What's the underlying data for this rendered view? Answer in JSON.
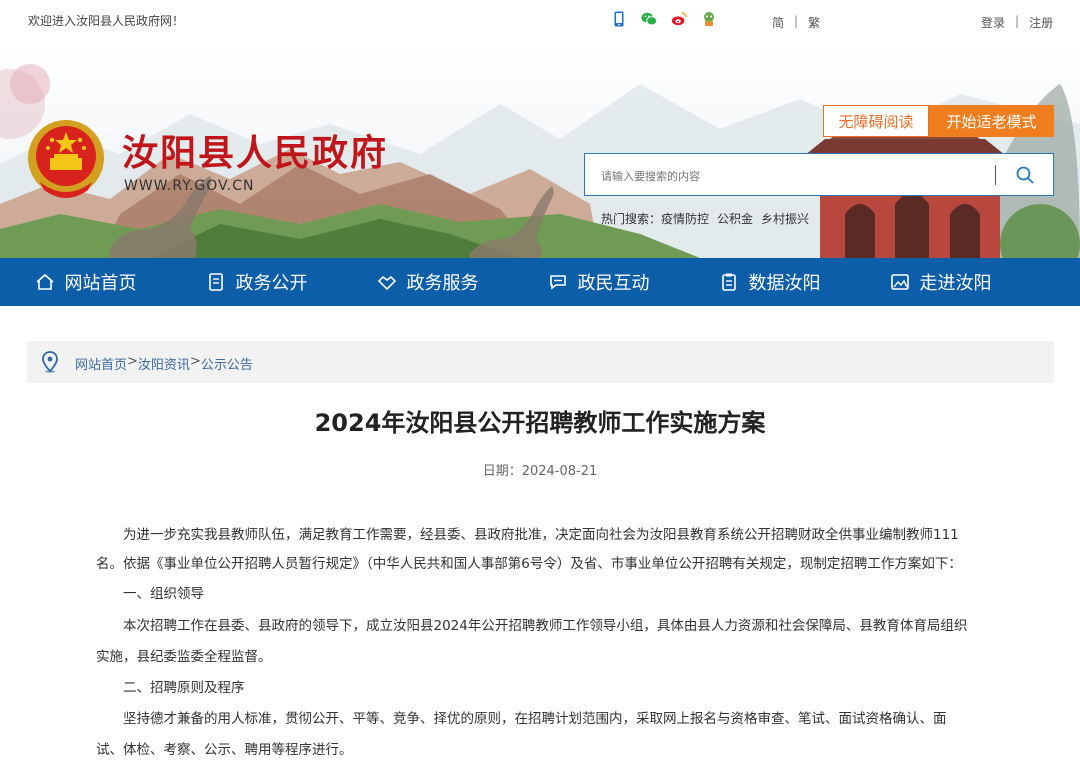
{
  "topbar": {
    "welcome": "欢迎进入汝阳县人民政府网！",
    "lang_simplified": "简",
    "lang_traditional": "繁",
    "login": "登录",
    "register": "注册",
    "separator": "|",
    "social_icons": [
      "mobile-icon",
      "wechat-icon",
      "weibo-icon",
      "mascot-icon"
    ]
  },
  "header": {
    "site_title": "汝阳县人民政府",
    "site_url": "WWW.RY.GOV.CN",
    "btn_accessible": "无障碍阅读",
    "btn_elder": "开始适老模式",
    "search_placeholder": "请输入要搜索的内容",
    "hot_label": "热门搜索：",
    "hot_items": [
      "疫情防控",
      "公积金",
      "乡村振兴"
    ]
  },
  "nav": {
    "items": [
      {
        "label": "网站首页",
        "icon": "home-icon"
      },
      {
        "label": "政务公开",
        "icon": "document-icon"
      },
      {
        "label": "政务服务",
        "icon": "handshake-icon"
      },
      {
        "label": "政民互动",
        "icon": "chat-icon"
      },
      {
        "label": "数据汝阳",
        "icon": "clipboard-icon"
      },
      {
        "label": "走进汝阳",
        "icon": "picture-icon"
      }
    ]
  },
  "breadcrumb": {
    "home": "网站首页",
    "section": "汝阳资讯",
    "current": "公示公告",
    "sep": ">"
  },
  "article": {
    "title": "2024年汝阳县公开招聘教师工作实施方案",
    "date_label": "日期：",
    "date": "2024-08-21",
    "lines": [
      "　　为进一步充实我县教师队伍，满足教育工作需要，经县委、县政府批准，决定面向社会为汝阳县教育系统公开招聘财政全供事业编制教师111",
      "名。依据《事业单位公开招聘人员暂行规定》（中华人民共和国人事部第6号令）及省、市事业单位公开招聘有关规定，现制定招聘工作方案如下：",
      "　　一、组织领导",
      "　　本次招聘工作在县委、县政府的领导下，成立汝阳县2024年公开招聘教师工作领导小组，具体由县人力资源和社会保障局、县教育体育局组织",
      "实施，县纪委监委全程监督。",
      "　　二、招聘原则及程序",
      "　　坚持德才兼备的用人标准，贯彻公开、平等、竞争、择优的原则，在招聘计划范围内，采取网上报名与资格审查、笔试、面试资格确认、面",
      "试、体检、考察、公示、聘用等程序进行。"
    ]
  },
  "colors": {
    "nav_blue": "#0d5ea8",
    "title_red": "#c0161b",
    "elder_orange": "#f07e1e"
  }
}
